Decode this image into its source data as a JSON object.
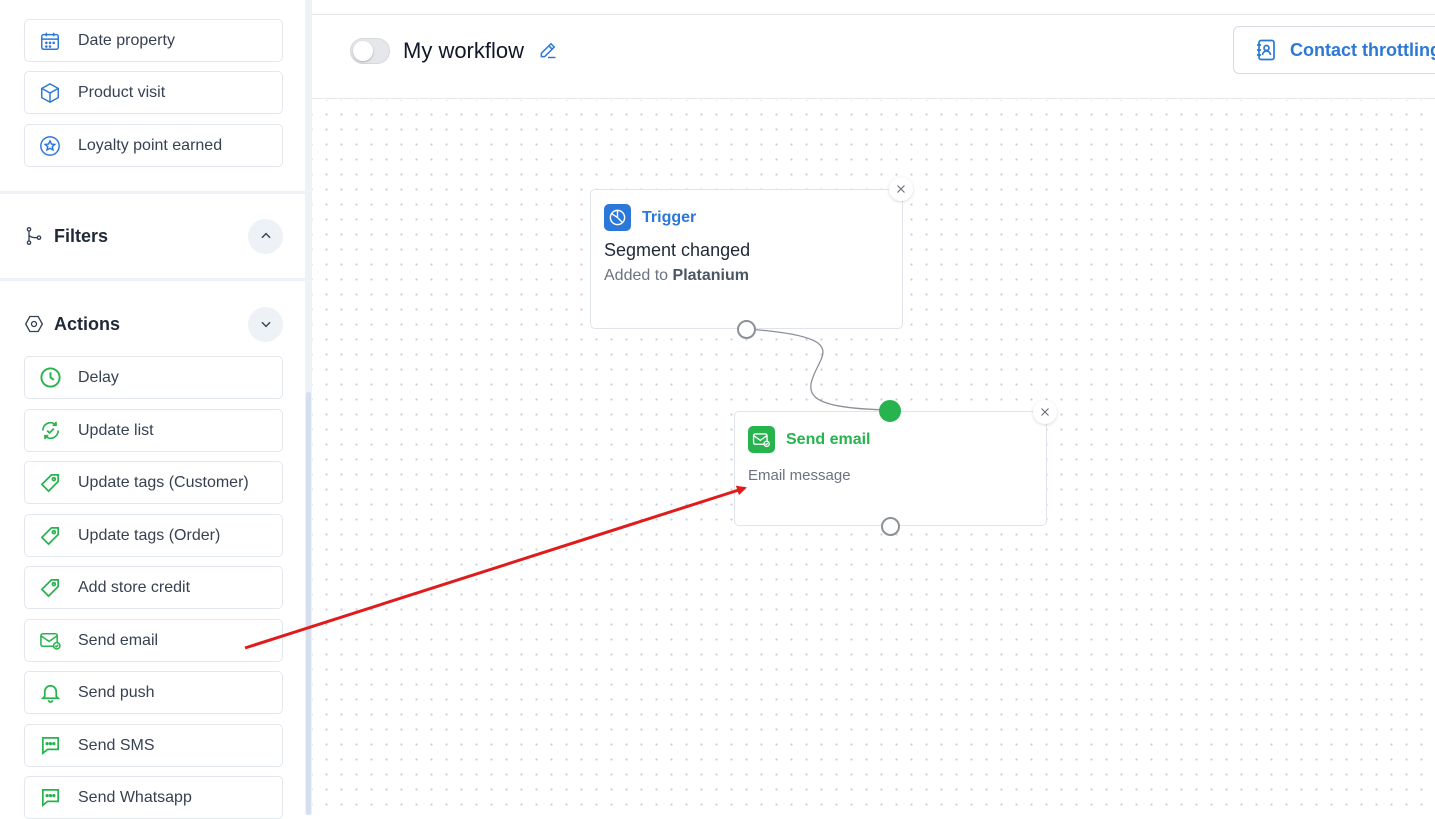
{
  "sidebar": {
    "top_items": [
      {
        "label": "Date property",
        "icon": "calendar-icon"
      },
      {
        "label": "Product visit",
        "icon": "cube-icon"
      },
      {
        "label": "Loyalty point earned",
        "icon": "star-badge-icon"
      }
    ],
    "filters": {
      "title": "Filters",
      "icon": "branch-icon"
    },
    "actions": {
      "title": "Actions",
      "icon": "hexagon-icon",
      "items": [
        {
          "label": "Delay",
          "icon": "clock-icon"
        },
        {
          "label": "Update list",
          "icon": "refresh-check-icon"
        },
        {
          "label": "Update tags (Customer)",
          "icon": "tag-icon"
        },
        {
          "label": "Update tags (Order)",
          "icon": "tag-icon"
        },
        {
          "label": "Add store credit",
          "icon": "tag-icon"
        },
        {
          "label": "Send email",
          "icon": "email-icon"
        },
        {
          "label": "Send push",
          "icon": "bell-icon"
        },
        {
          "label": "Send SMS",
          "icon": "chat-icon"
        },
        {
          "label": "Send Whatsapp",
          "icon": "chat-icon"
        }
      ]
    }
  },
  "header": {
    "workflow_title": "My workflow",
    "toggle_enabled": false,
    "throttle_label": "Contact throttling"
  },
  "canvas": {
    "trigger_node": {
      "type_label": "Trigger",
      "heading": "Segment changed",
      "desc_prefix": "Added to",
      "desc_value": "Platanium"
    },
    "email_node": {
      "type_label": "Send email",
      "desc": "Email message"
    }
  },
  "colors": {
    "accent_blue": "#2b78d8",
    "accent_green": "#27b34e",
    "annotation_red": "#e01b1b"
  }
}
